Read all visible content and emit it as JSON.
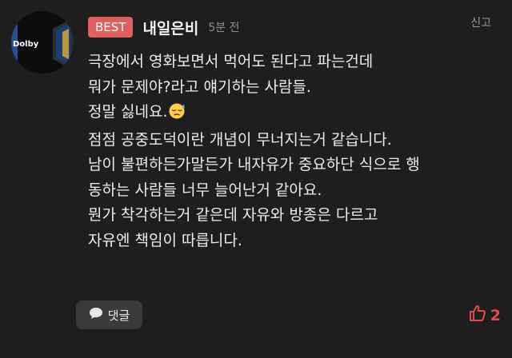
{
  "post": {
    "badge": "BEST",
    "username": "내일은비",
    "time": "5분 전",
    "report_label": "신고",
    "avatar_text": "Dolby",
    "lines": [
      "극장에서 영화보면서 먹어도 된다고 파는건데",
      "뭐가 문제야?라고 얘기하는 사람들.",
      "정말 싫네요.",
      "점점 공중도덕이란 개념이 무너지는거 같습니다.",
      "남이 불편하든가말든가 내자유가 중요하단 식으로 행",
      "동하는 사람들 너무 늘어난거 같아요.",
      "뭔가 착각하는거 같은데 자유와 방종은 다르고",
      "자유엔 책임이 따릅니다."
    ]
  },
  "actions": {
    "comment_label": "댓글",
    "like_count": "2"
  },
  "icons": {
    "comment": "speech-bubble-icon",
    "like": "thumbs-up-icon",
    "emoji": "sad-face-emoji"
  },
  "colors": {
    "background": "#1e1e1e",
    "badge": "#e25d5d",
    "like": "#e34b4b"
  }
}
